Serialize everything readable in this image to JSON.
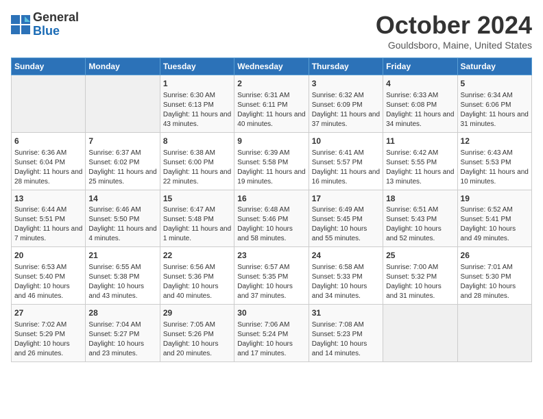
{
  "logo": {
    "general": "General",
    "blue": "Blue"
  },
  "title": "October 2024",
  "location": "Gouldsboro, Maine, United States",
  "days_header": [
    "Sunday",
    "Monday",
    "Tuesday",
    "Wednesday",
    "Thursday",
    "Friday",
    "Saturday"
  ],
  "weeks": [
    [
      {
        "day": "",
        "info": ""
      },
      {
        "day": "",
        "info": ""
      },
      {
        "day": "1",
        "info": "Sunrise: 6:30 AM\nSunset: 6:13 PM\nDaylight: 11 hours and 43 minutes."
      },
      {
        "day": "2",
        "info": "Sunrise: 6:31 AM\nSunset: 6:11 PM\nDaylight: 11 hours and 40 minutes."
      },
      {
        "day": "3",
        "info": "Sunrise: 6:32 AM\nSunset: 6:09 PM\nDaylight: 11 hours and 37 minutes."
      },
      {
        "day": "4",
        "info": "Sunrise: 6:33 AM\nSunset: 6:08 PM\nDaylight: 11 hours and 34 minutes."
      },
      {
        "day": "5",
        "info": "Sunrise: 6:34 AM\nSunset: 6:06 PM\nDaylight: 11 hours and 31 minutes."
      }
    ],
    [
      {
        "day": "6",
        "info": "Sunrise: 6:36 AM\nSunset: 6:04 PM\nDaylight: 11 hours and 28 minutes."
      },
      {
        "day": "7",
        "info": "Sunrise: 6:37 AM\nSunset: 6:02 PM\nDaylight: 11 hours and 25 minutes."
      },
      {
        "day": "8",
        "info": "Sunrise: 6:38 AM\nSunset: 6:00 PM\nDaylight: 11 hours and 22 minutes."
      },
      {
        "day": "9",
        "info": "Sunrise: 6:39 AM\nSunset: 5:58 PM\nDaylight: 11 hours and 19 minutes."
      },
      {
        "day": "10",
        "info": "Sunrise: 6:41 AM\nSunset: 5:57 PM\nDaylight: 11 hours and 16 minutes."
      },
      {
        "day": "11",
        "info": "Sunrise: 6:42 AM\nSunset: 5:55 PM\nDaylight: 11 hours and 13 minutes."
      },
      {
        "day": "12",
        "info": "Sunrise: 6:43 AM\nSunset: 5:53 PM\nDaylight: 11 hours and 10 minutes."
      }
    ],
    [
      {
        "day": "13",
        "info": "Sunrise: 6:44 AM\nSunset: 5:51 PM\nDaylight: 11 hours and 7 minutes."
      },
      {
        "day": "14",
        "info": "Sunrise: 6:46 AM\nSunset: 5:50 PM\nDaylight: 11 hours and 4 minutes."
      },
      {
        "day": "15",
        "info": "Sunrise: 6:47 AM\nSunset: 5:48 PM\nDaylight: 11 hours and 1 minute."
      },
      {
        "day": "16",
        "info": "Sunrise: 6:48 AM\nSunset: 5:46 PM\nDaylight: 10 hours and 58 minutes."
      },
      {
        "day": "17",
        "info": "Sunrise: 6:49 AM\nSunset: 5:45 PM\nDaylight: 10 hours and 55 minutes."
      },
      {
        "day": "18",
        "info": "Sunrise: 6:51 AM\nSunset: 5:43 PM\nDaylight: 10 hours and 52 minutes."
      },
      {
        "day": "19",
        "info": "Sunrise: 6:52 AM\nSunset: 5:41 PM\nDaylight: 10 hours and 49 minutes."
      }
    ],
    [
      {
        "day": "20",
        "info": "Sunrise: 6:53 AM\nSunset: 5:40 PM\nDaylight: 10 hours and 46 minutes."
      },
      {
        "day": "21",
        "info": "Sunrise: 6:55 AM\nSunset: 5:38 PM\nDaylight: 10 hours and 43 minutes."
      },
      {
        "day": "22",
        "info": "Sunrise: 6:56 AM\nSunset: 5:36 PM\nDaylight: 10 hours and 40 minutes."
      },
      {
        "day": "23",
        "info": "Sunrise: 6:57 AM\nSunset: 5:35 PM\nDaylight: 10 hours and 37 minutes."
      },
      {
        "day": "24",
        "info": "Sunrise: 6:58 AM\nSunset: 5:33 PM\nDaylight: 10 hours and 34 minutes."
      },
      {
        "day": "25",
        "info": "Sunrise: 7:00 AM\nSunset: 5:32 PM\nDaylight: 10 hours and 31 minutes."
      },
      {
        "day": "26",
        "info": "Sunrise: 7:01 AM\nSunset: 5:30 PM\nDaylight: 10 hours and 28 minutes."
      }
    ],
    [
      {
        "day": "27",
        "info": "Sunrise: 7:02 AM\nSunset: 5:29 PM\nDaylight: 10 hours and 26 minutes."
      },
      {
        "day": "28",
        "info": "Sunrise: 7:04 AM\nSunset: 5:27 PM\nDaylight: 10 hours and 23 minutes."
      },
      {
        "day": "29",
        "info": "Sunrise: 7:05 AM\nSunset: 5:26 PM\nDaylight: 10 hours and 20 minutes."
      },
      {
        "day": "30",
        "info": "Sunrise: 7:06 AM\nSunset: 5:24 PM\nDaylight: 10 hours and 17 minutes."
      },
      {
        "day": "31",
        "info": "Sunrise: 7:08 AM\nSunset: 5:23 PM\nDaylight: 10 hours and 14 minutes."
      },
      {
        "day": "",
        "info": ""
      },
      {
        "day": "",
        "info": ""
      }
    ]
  ]
}
